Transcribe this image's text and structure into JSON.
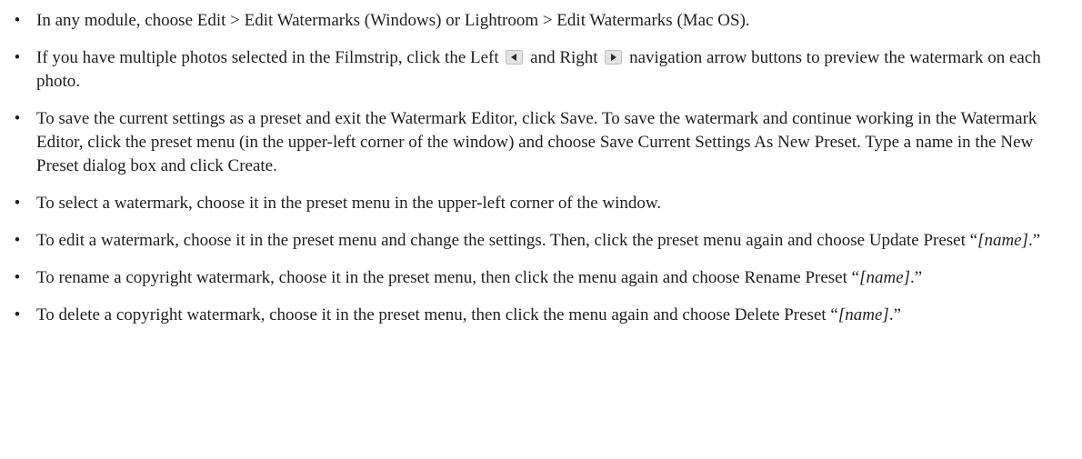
{
  "bullets": [
    {
      "text": "In any module, choose Edit > Edit Watermarks (Windows) or Lightroom > Edit Watermarks (Mac OS)."
    },
    {
      "part1": "If you have multiple photos selected in the Filmstrip, click the Left",
      "part2": "and Right",
      "part3": "navigation arrow buttons to preview the watermark on each photo.",
      "icons": [
        "left-arrow-icon",
        "right-arrow-icon"
      ]
    },
    {
      "text": "To save the current settings as a preset and exit the Watermark Editor, click Save. To save the watermark and continue working in the Watermark Editor, click the preset menu (in the upper-left corner of the window) and choose Save Current Settings As New Preset. Type a name in the New Preset dialog box and click Create."
    },
    {
      "text": "To select a watermark, choose it in the preset menu in the upper-left corner of the window."
    },
    {
      "pre": "To edit a watermark, choose it in the preset menu and change the settings. Then, click the preset menu again and choose Update Preset “",
      "name": "[name]",
      "post": ".”"
    },
    {
      "pre": "To rename a copyright watermark, choose it in the preset menu, then click the menu again and choose Rename Preset “",
      "name": "[name]",
      "post": ".”"
    },
    {
      "pre": "To delete a copyright watermark, choose it in the preset menu, then click the menu again and choose Delete Preset “",
      "name": "[name]",
      "post": ".”"
    }
  ],
  "bullet_glyph": "•",
  "colors": {
    "text": "#1f1f1f",
    "arrow_icon_bg": "#d9d9d9",
    "arrow_icon_fg": "#2b2b2b"
  }
}
